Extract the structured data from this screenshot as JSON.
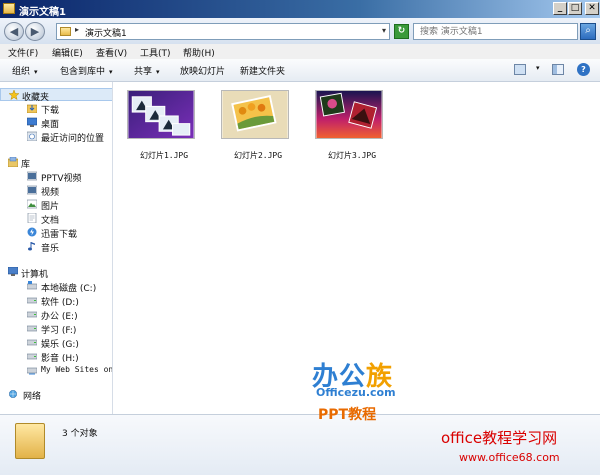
{
  "window": {
    "title": "演示文稿1",
    "controls": {
      "minimize": "_",
      "maximize": "□",
      "close": "✕"
    }
  },
  "address": {
    "separator": "▸",
    "path": "演示文稿1",
    "dropdown": "▾",
    "refresh": "↻",
    "search_placeholder": "搜索 演示文稿1",
    "search_icon": "⌕"
  },
  "nav_buttons": {
    "back": "◀",
    "forward": "▶"
  },
  "menu": [
    "文件(F)",
    "编辑(E)",
    "查看(V)",
    "工具(T)",
    "帮助(H)"
  ],
  "command_bar": {
    "organize": "组织",
    "include_in_library": "包含到库中",
    "share": "共享",
    "slideshow": "放映幻灯片",
    "new_folder": "新建文件夹",
    "arrow": "▾",
    "help": "?"
  },
  "nav": {
    "favorites": {
      "label": "收藏夹",
      "items": [
        "下载",
        "桌面",
        "最近访问的位置"
      ]
    },
    "libraries": {
      "label": "库",
      "items": [
        "PPTV视频",
        "视频",
        "图片",
        "文档",
        "迅雷下载",
        "音乐"
      ]
    },
    "computer": {
      "label": "计算机",
      "items": [
        "本地磁盘 (C:)",
        "软件 (D:)",
        "办公 (E:)",
        "学习 (F:)",
        "娱乐 (G:)",
        "影音 (H:)",
        "My Web Sites on"
      ]
    },
    "network": {
      "label": "网络"
    }
  },
  "files": [
    {
      "name": "幻灯片1.JPG"
    },
    {
      "name": "幻灯片2.JPG"
    },
    {
      "name": "幻灯片3.JPG"
    }
  ],
  "status": {
    "count": "3 个对象"
  },
  "watermarks": {
    "logo_main": "办公",
    "logo_accent": "族",
    "site": "Officezu.com",
    "ppt": "PPT教程",
    "red_title": "office教程学习网",
    "red_url": "www.office68.com"
  }
}
